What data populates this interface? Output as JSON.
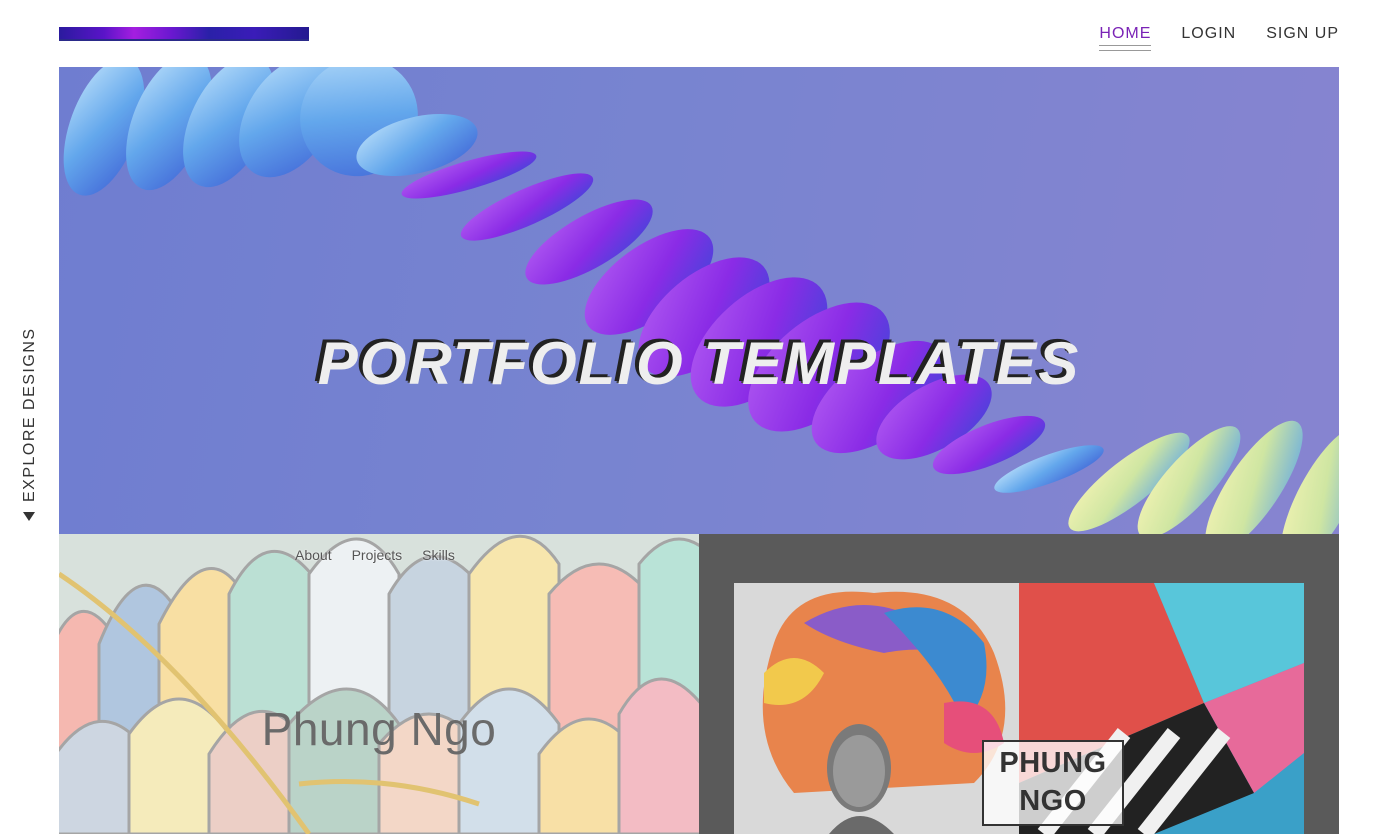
{
  "header": {
    "nav": [
      {
        "label": "HOME",
        "active": true
      },
      {
        "label": "LOGIN",
        "active": false
      },
      {
        "label": "SIGN UP",
        "active": false
      }
    ]
  },
  "sidebar": {
    "explore_label": "EXPLORE DESIGNS"
  },
  "hero": {
    "title": "PORTFOLIO TEMPLATES"
  },
  "cards": [
    {
      "nav": [
        "About",
        "Projects",
        "Skills"
      ],
      "name": "Phung Ngo"
    },
    {
      "name_line1": "PHUNG",
      "name_line2": "NGO"
    }
  ],
  "colors": {
    "accent": "#7a23b6",
    "hero_bg": "#7884d0",
    "text": "#333333"
  }
}
